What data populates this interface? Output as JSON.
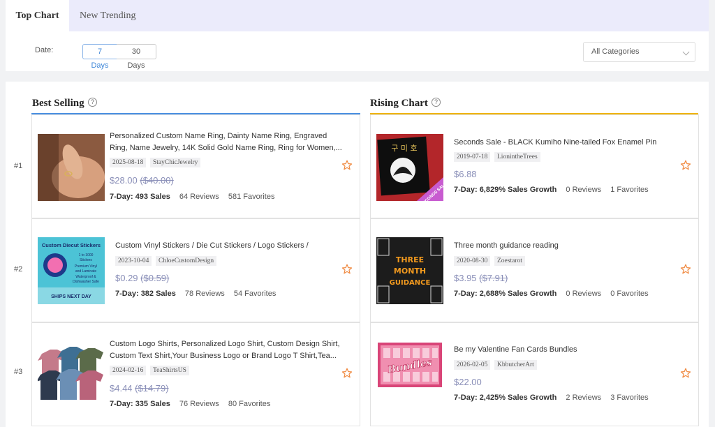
{
  "tabs": [
    {
      "label": "Top Chart",
      "active": true
    },
    {
      "label": "New Trending",
      "active": false
    }
  ],
  "filters": {
    "date_label": "Date:",
    "range_options": [
      "7 Days",
      "30 Days"
    ],
    "selected_range": "7 Days",
    "category": "All Categories"
  },
  "colors": {
    "best_selling_rule": "#4a90e2",
    "rising_chart_rule": "#f0b400",
    "price": "#8a8fb8",
    "star": "#f0883e"
  },
  "best_selling": {
    "title": "Best Selling",
    "items": [
      {
        "rank": "#1",
        "title_line1": "Personalized Custom Name Ring, Dainty Name Ring, Engraved",
        "title_line2": "Ring, Name Jewelry, 14K Solid Gold Name Ring, Ring for Women,...",
        "date": "2025-08-18",
        "shop": "StayChicJewelry",
        "price": "$28.00",
        "old_price": "($40.00)",
        "period": "7-Day:",
        "sales": "493 Sales",
        "reviews": "64 Reviews",
        "favorites": "581 Favorites"
      },
      {
        "rank": "#2",
        "title_line1": "Custom Vinyl Stickers / Die Cut Stickers / Logo Stickers /",
        "title_line2": "",
        "date": "2023-10-04",
        "shop": "ChloeCustomDesign",
        "price": "$0.29",
        "old_price": "($0.59)",
        "period": "7-Day:",
        "sales": "382 Sales",
        "reviews": "78 Reviews",
        "favorites": "54 Favorites",
        "thumb_text": {
          "heading": "Custom Diecut Stickers",
          "line1": "1 to 1000",
          "line2": "Stickers",
          "line3": "Premium Vinyl",
          "line4": "and Laminate",
          "line5": "Waterproof &",
          "line6": "Dishwasher Safe",
          "footer": "SHIPS NEXT DAY"
        }
      },
      {
        "rank": "#3",
        "title_line1": "Custom Logo Shirts, Personalized Logo Shirt, Custom Design Shirt,",
        "title_line2": "Custom Text Shirt,Your Business Logo or Brand Logo T Shirt,Tea...",
        "date": "2024-02-16",
        "shop": "TeaShirtsUS",
        "price": "$4.44",
        "old_price": "($14.79)",
        "period": "7-Day:",
        "sales": "335 Sales",
        "reviews": "76 Reviews",
        "favorites": "80 Favorites"
      }
    ]
  },
  "rising_chart": {
    "title": "Rising Chart",
    "items": [
      {
        "title_line1": "Seconds Sale - BLACK Kumiho Nine-tailed Fox Enamel Pin",
        "date": "2019-07-18",
        "shop": "LionintheTrees",
        "price": "$6.88",
        "old_price": "",
        "period": "7-Day:",
        "growth": "6,829% Sales Growth",
        "reviews": "0 Reviews",
        "favorites": "1 Favorites",
        "thumb_text": {
          "top": "구 미 호",
          "ribbon": "SECONDS SALE"
        }
      },
      {
        "title_line1": "Three month guidance reading",
        "date": "2020-08-30",
        "shop": "Zoestarot",
        "price": "$3.95",
        "old_price": "($7.91)",
        "period": "7-Day:",
        "growth": "2,688% Sales Growth",
        "reviews": "0 Reviews",
        "favorites": "0 Favorites",
        "thumb_text": {
          "line1": "THREE",
          "line2": "MONTH",
          "line3": "GUIDANCE"
        }
      },
      {
        "title_line1": "Be my Valentine Fan Cards Bundles",
        "date": "2026-02-05",
        "shop": "KbbutcherArt",
        "price": "$22.00",
        "old_price": "",
        "period": "7-Day:",
        "growth": "2,425% Sales Growth",
        "reviews": "2 Reviews",
        "favorites": "3 Favorites",
        "thumb_text": {
          "word": "Bundles"
        }
      }
    ]
  }
}
